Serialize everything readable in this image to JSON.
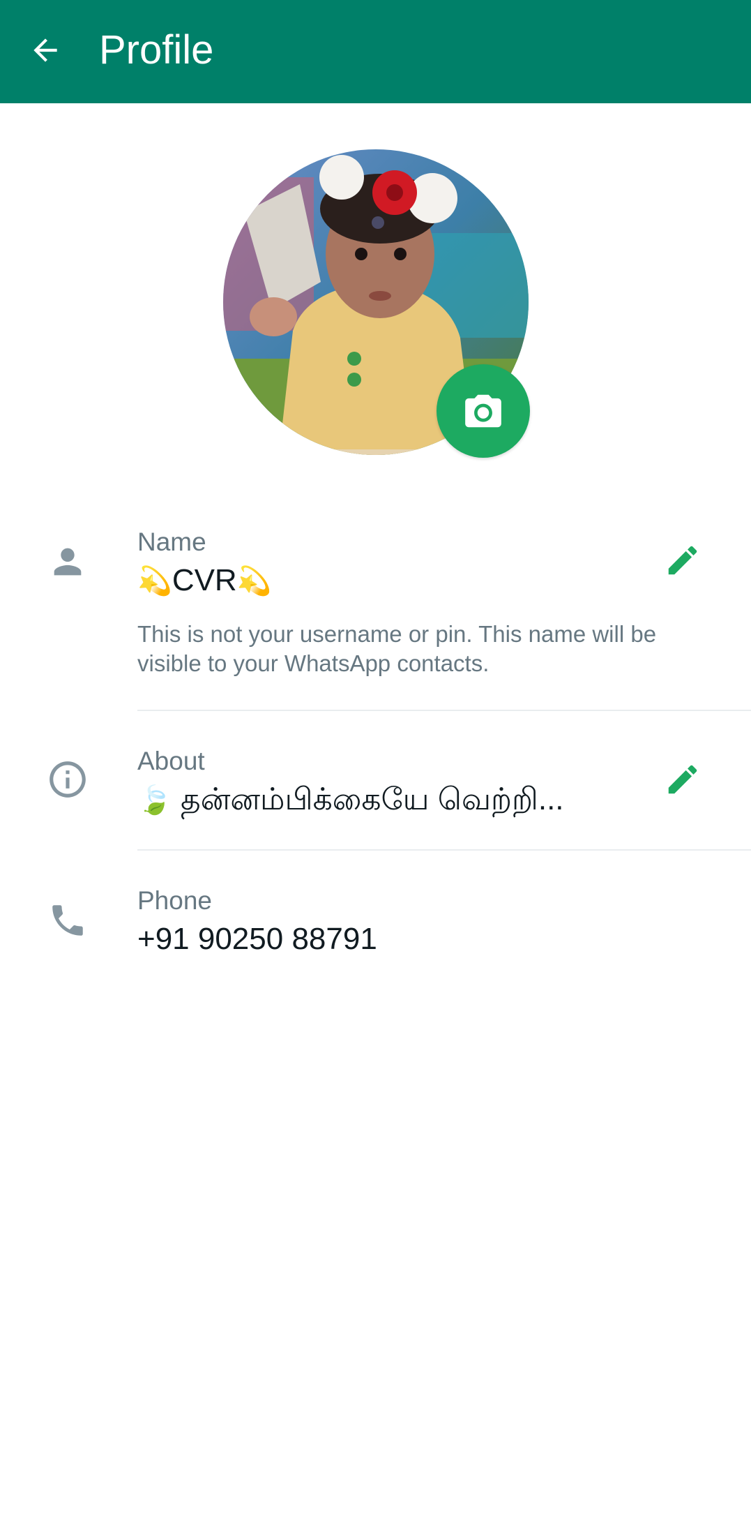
{
  "header": {
    "title": "Profile",
    "back_icon": "arrow-left-icon"
  },
  "colors": {
    "header_bg": "#008069",
    "accent": "#1daa61",
    "label": "#667781",
    "value": "#111b21",
    "divider": "#e9edef"
  },
  "avatar": {
    "camera_icon": "camera-icon"
  },
  "name": {
    "label": "Name",
    "value_prefix": "💫",
    "value_text": "CVR",
    "value_suffix": "💫",
    "helper": "This is not your username or pin. This name will be visible to your WhatsApp contacts.",
    "icon": "person-icon",
    "edit_icon": "pencil-icon"
  },
  "about": {
    "label": "About",
    "value_prefix": "🍃",
    "value_text": "தன்னம்பிக்கையே வெற்றி...",
    "icon": "info-icon",
    "edit_icon": "pencil-icon"
  },
  "phone": {
    "label": "Phone",
    "value": "+91 90250 88791",
    "icon": "phone-icon"
  }
}
